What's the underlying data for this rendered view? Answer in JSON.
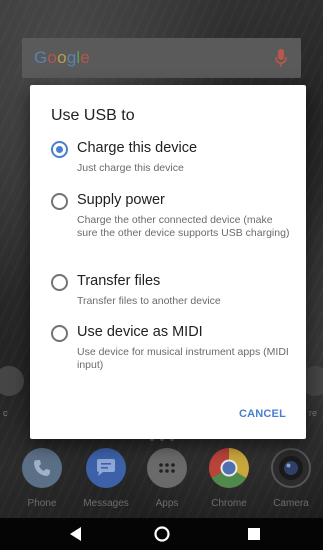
{
  "home": {
    "search_brand": "Google",
    "side_left_text": "c",
    "side_right_text": "re",
    "dock": [
      {
        "label": "Phone",
        "icon": "phone-icon",
        "color": "#5b6f86"
      },
      {
        "label": "Messages",
        "icon": "messages-icon",
        "color": "#3d61a8"
      },
      {
        "label": "Apps",
        "icon": "apps-icon",
        "color": "#6a6a6a"
      },
      {
        "label": "Chrome",
        "icon": "chrome-icon",
        "color": "#c03a2b"
      },
      {
        "label": "Camera",
        "icon": "camera-icon",
        "color": "#2b2b2b"
      }
    ]
  },
  "dialog": {
    "title": "Use USB to",
    "options": [
      {
        "label": "Charge this device",
        "description": "Just charge this device",
        "selected": true
      },
      {
        "label": "Supply power",
        "description": "Charge the other connected device (make sure the other device supports USB charging)",
        "selected": false
      },
      {
        "label": "Transfer files",
        "description": "Transfer files to another device",
        "selected": false
      },
      {
        "label": "Use device as MIDI",
        "description": "Use device for musical instrument apps (MIDI input)",
        "selected": false
      }
    ],
    "cancel_label": "CANCEL"
  },
  "colors": {
    "accent": "#4a7fcf",
    "dialog_bg": "#ffffff",
    "nav_bar": "#050505"
  },
  "nav": {
    "back_icon": "back-triangle-icon",
    "home_icon": "home-circle-icon",
    "recents_icon": "recents-square-icon"
  }
}
